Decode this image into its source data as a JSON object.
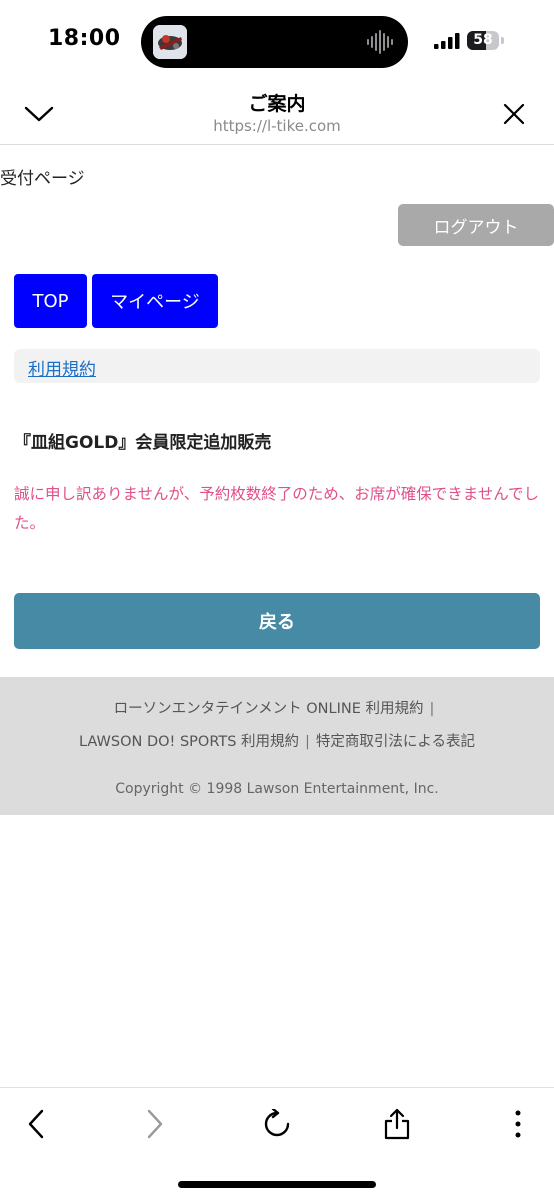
{
  "status_bar": {
    "time": "18:00",
    "battery": "58",
    "battery_level": 0.58,
    "icons": [
      "app-thumbnail-icon",
      "audio-waveform-icon",
      "signal-bars-icon",
      "battery-icon"
    ]
  },
  "browser": {
    "title": "ご案内",
    "url": "https://l-tike.com",
    "icons": [
      "chevron-down-icon",
      "close-icon"
    ]
  },
  "page": {
    "reception_label": "受付ページ",
    "logout_label": "ログアウト",
    "nav": {
      "top_label": "TOP",
      "mypage_label": "マイページ"
    },
    "terms_label": "利用規約",
    "event_title": "『皿組GOLD』会員限定追加販売",
    "error_message": "誠に申し訳ありませんが、予約枚数終了のため、お席が確保できませんでした。",
    "back_label": "戻る"
  },
  "footer": {
    "link_entertainment": "ローソンエンタテインメント ONLINE 利用規約",
    "link_sports": "LAWSON DO! SPORTS 利用規約",
    "link_legal": "特定商取引法による表記",
    "separator": "|",
    "copyright": "Copyright © 1998 Lawson Entertainment, Inc."
  },
  "toolbar": {
    "icons": [
      "back-icon",
      "forward-icon",
      "reload-icon",
      "share-icon",
      "more-icon"
    ]
  },
  "colors": {
    "blue_button": "#0000ff",
    "back_button": "#468aa6",
    "logout_button": "#a9a9a9",
    "error_text": "#e0508a",
    "link": "#1a6fc9",
    "footer_bg": "#dcdcdc"
  }
}
